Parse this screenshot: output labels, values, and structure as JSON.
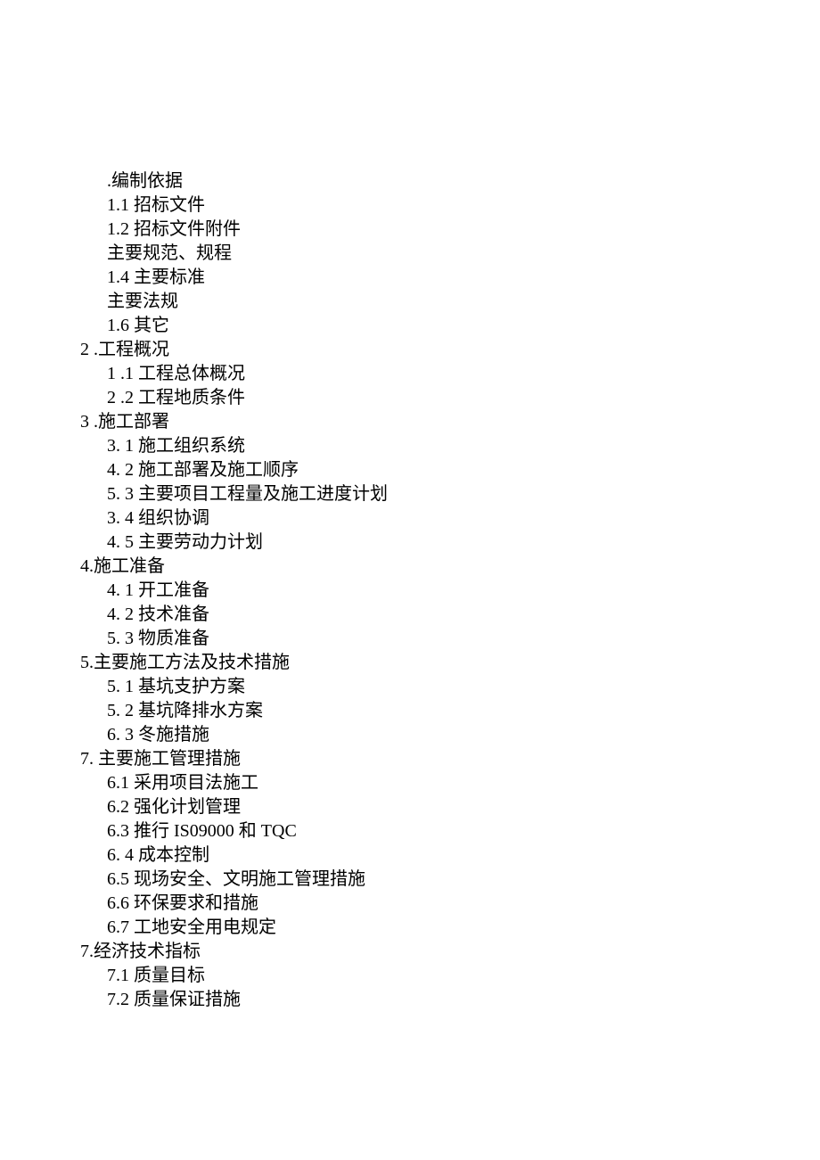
{
  "toc": [
    {
      "level": 2,
      "text": ".编制依据"
    },
    {
      "level": 2,
      "text": "1.1 招标文件"
    },
    {
      "level": 2,
      "text": "1.2 招标文件附件"
    },
    {
      "level": 2,
      "text": "主要规范、规程"
    },
    {
      "level": 2,
      "text": "1.4 主要标准"
    },
    {
      "level": 2,
      "text": "主要法规"
    },
    {
      "level": 2,
      "text": "1.6 其它"
    },
    {
      "level": 1,
      "text": "2 .工程概况"
    },
    {
      "level": 2,
      "text": "1 .1 工程总体概况"
    },
    {
      "level": 2,
      "text": "2 .2 工程地质条件"
    },
    {
      "level": 1,
      "text": "3 .施工部署"
    },
    {
      "level": 2,
      "text": "3. 1 施工组织系统"
    },
    {
      "level": 2,
      "text": "4. 2 施工部署及施工顺序"
    },
    {
      "level": 2,
      "text": "5. 3 主要项目工程量及施工进度计划"
    },
    {
      "level": 2,
      "text": "3. 4 组织协调"
    },
    {
      "level": 2,
      "text": "4. 5 主要劳动力计划"
    },
    {
      "level": 1,
      "text": "4.施工准备"
    },
    {
      "level": 2,
      "text": "4. 1 开工准备"
    },
    {
      "level": 2,
      "text": "4. 2 技术准备"
    },
    {
      "level": 2,
      "text": "5. 3 物质准备"
    },
    {
      "level": 1,
      "text": "5.主要施工方法及技术措施"
    },
    {
      "level": 2,
      "text": "5. 1 基坑支护方案"
    },
    {
      "level": 2,
      "text": "5. 2 基坑降排水方案"
    },
    {
      "level": 2,
      "text": "6. 3 冬施措施"
    },
    {
      "level": 1,
      "text": "7. 主要施工管理措施"
    },
    {
      "level": 2,
      "text": "6.1 采用项目法施工"
    },
    {
      "level": 2,
      "text": "6.2 强化计划管理"
    },
    {
      "level": 2,
      "text": "6.3 推行 IS09000 和 TQC"
    },
    {
      "level": 2,
      "text": "6. 4 成本控制"
    },
    {
      "level": 2,
      "text": "6.5 现场安全、文明施工管理措施"
    },
    {
      "level": 2,
      "text": "6.6 环保要求和措施"
    },
    {
      "level": 2,
      "text": "6.7 工地安全用电规定"
    },
    {
      "level": 1,
      "text": "7.经济技术指标"
    },
    {
      "level": 2,
      "text": "7.1 质量目标"
    },
    {
      "level": 2,
      "text": "7.2 质量保证措施"
    }
  ]
}
